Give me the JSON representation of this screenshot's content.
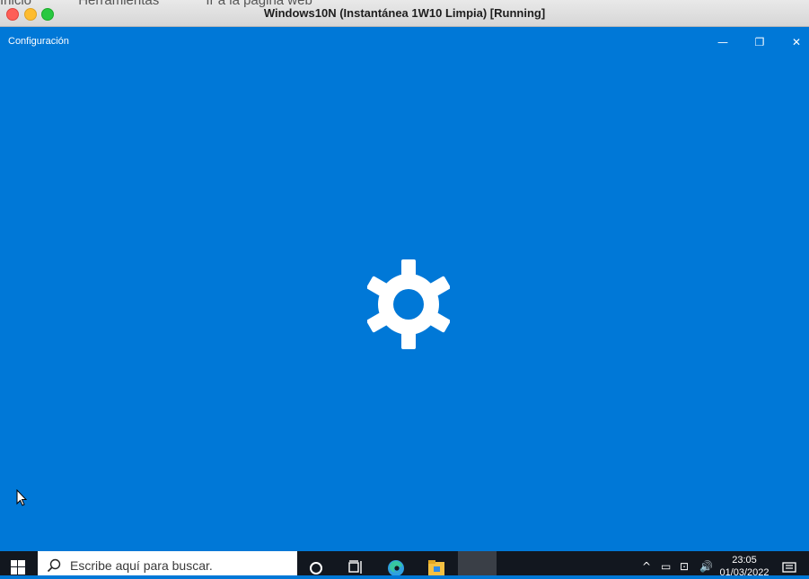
{
  "host_window": {
    "ghost_menu": [
      "Inicio",
      "Herramientas",
      "Ir a la página web"
    ],
    "title": "Windows10N (Instantánea 1W10 Limpia) [Running]"
  },
  "app": {
    "title": "Configuración",
    "caption_buttons": {
      "minimize": "—",
      "restore": "❐",
      "close": "✕"
    },
    "splash_icon": "gear-icon",
    "background_color": "#0078d7"
  },
  "taskbar": {
    "search_placeholder": "Escribe aquí para buscar.",
    "pinned": [
      "cortana-icon",
      "task-view-icon",
      "edge-icon",
      "file-explorer-icon",
      "settings-icon"
    ],
    "tray": {
      "chevron": "^",
      "battery": "▭",
      "network": "⊡",
      "volume": "🔊"
    },
    "clock": {
      "time": "23:05",
      "date": "01/03/2022"
    }
  }
}
